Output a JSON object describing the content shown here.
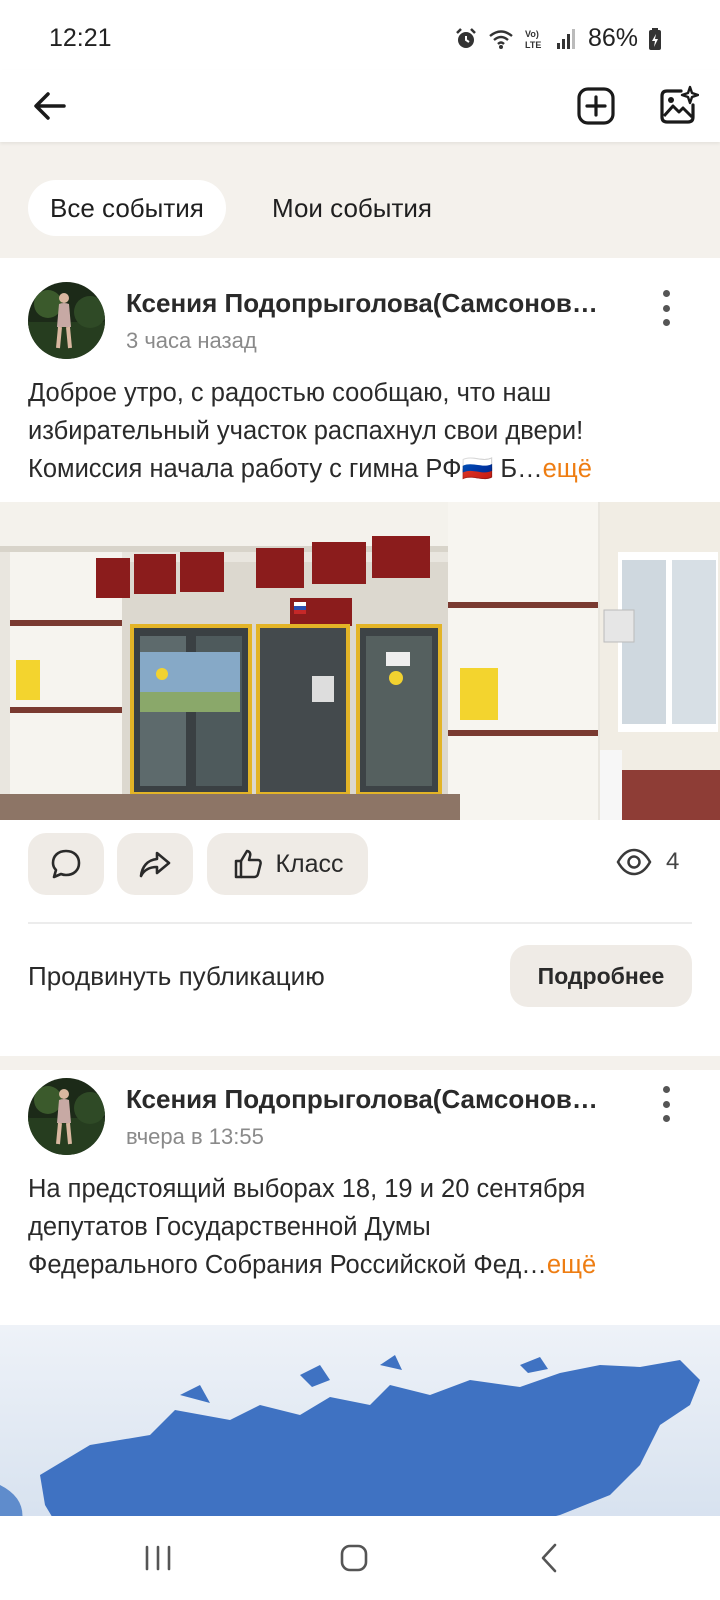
{
  "status_bar": {
    "time": "12:21",
    "battery": "86%",
    "icons": [
      "alarm-icon",
      "wifi-icon",
      "volte-icon",
      "signal-icon",
      "battery-icon"
    ]
  },
  "top_bar": {
    "icons": [
      "back-arrow-icon",
      "add-square-icon",
      "photo-sparkle-icon"
    ]
  },
  "tabs": [
    {
      "label": "Все события",
      "active": true
    },
    {
      "label": "Мои события",
      "active": false
    }
  ],
  "posts": [
    {
      "author": "Ксения Подопрыголова(Самсонов…",
      "time": "3 часа назад",
      "text_lines": [
        "Доброе утро, с радостью сообщаю, что наш",
        "избирательный участок распахнул свои двери!",
        "Комиссия начала работу  с гимна РФ🇷🇺 Б…"
      ],
      "more_label": "ещё",
      "actions": {
        "like_label": "Класс",
        "views": "4"
      },
      "promote": {
        "text": "Продвинуть публикацию",
        "button": "Подробнее"
      }
    },
    {
      "author": "Ксения Подопрыголова(Самсонов…",
      "time": "вчера в 13:55",
      "text_lines": [
        "На предстоящий выборах 18, 19 и 20 сентября",
        "депутатов Государственной Думы",
        "Федерального Собрания Российской Фед…"
      ],
      "more_label": "ещё"
    }
  ],
  "colors": {
    "accent_more": "#ee7d12",
    "background": "#f4f1ec",
    "button_bg": "#efebe6"
  }
}
